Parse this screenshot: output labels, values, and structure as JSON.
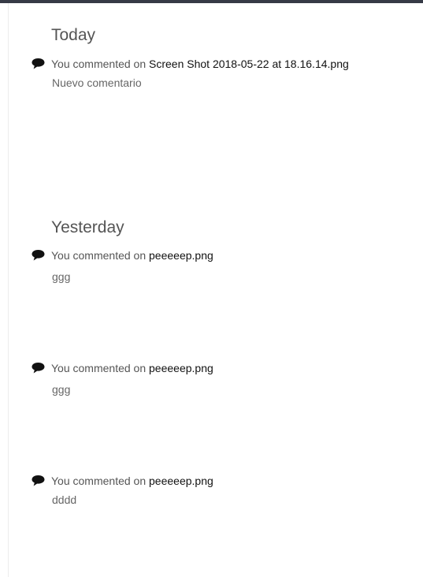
{
  "sections": [
    {
      "title": "Today",
      "items": [
        {
          "prefix": "You commented on",
          "file": "Screen Shot 2018-05-22 at 18.16.14.png",
          "comment": "Nuevo comentario"
        }
      ]
    },
    {
      "title": "Yesterday",
      "items": [
        {
          "prefix": "You commented on",
          "file": "peeeeep.png",
          "comment": "ggg"
        },
        {
          "prefix": "You commented on",
          "file": "peeeeep.png",
          "comment": "ggg"
        },
        {
          "prefix": "You commented on",
          "file": "peeeeep.png",
          "comment": "dddd"
        }
      ]
    }
  ],
  "icons": {
    "activity": "comment-bubble-icon"
  },
  "colors": {
    "topbar": "#363a46",
    "text": "#555555",
    "file": "#111111"
  }
}
